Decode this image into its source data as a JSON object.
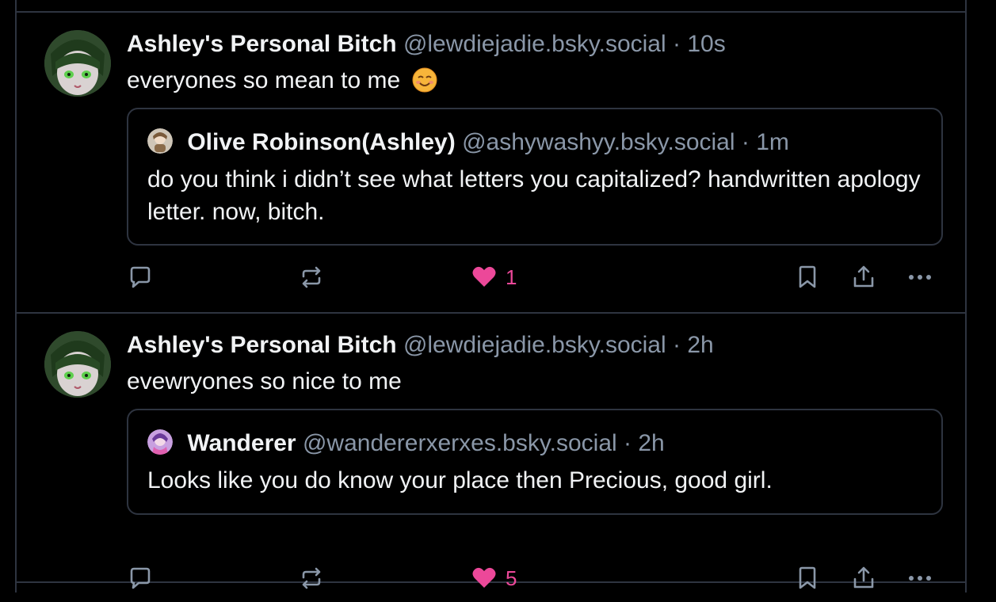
{
  "colors": {
    "background": "#000000",
    "border": "#2e3440",
    "text_primary": "#f1f3f5",
    "text_secondary": "#8a97a8",
    "like_active": "#ec4899"
  },
  "posts": [
    {
      "author_name": "Ashley's Personal Bitch",
      "author_handle": "@lewdiejadie.bsky.social",
      "separator": "·",
      "time": "10s",
      "text": "everyones so mean to me",
      "emoji": "smiling-face-emoji",
      "quote": {
        "author_name": "Olive Robinson(Ashley)",
        "author_handle": "@ashywashyy.bsky.social",
        "separator": "·",
        "time": "1m",
        "text": "do you think i didn’t see what letters you capitalized? handwritten apology letter. now, bitch."
      },
      "actions": {
        "reply_icon": "reply-icon",
        "repost_icon": "repost-icon",
        "like_icon": "heart-icon",
        "like_count": "1",
        "bookmark_icon": "bookmark-icon",
        "share_icon": "share-icon",
        "more_icon": "more-icon"
      }
    },
    {
      "author_name": "Ashley's Personal Bitch",
      "author_handle": "@lewdiejadie.bsky.social",
      "separator": "·",
      "time": "2h",
      "text": "evewryones so nice to me",
      "quote": {
        "author_name": "Wanderer",
        "author_handle": "@wandererxerxes.bsky.social",
        "separator": "·",
        "time": "2h",
        "text": "Looks like you do know your place then Precious, good girl."
      },
      "actions": {
        "reply_icon": "reply-icon",
        "repost_icon": "repost-icon",
        "like_icon": "heart-icon",
        "like_count": "5",
        "bookmark_icon": "bookmark-icon",
        "share_icon": "share-icon",
        "more_icon": "more-icon"
      }
    }
  ]
}
